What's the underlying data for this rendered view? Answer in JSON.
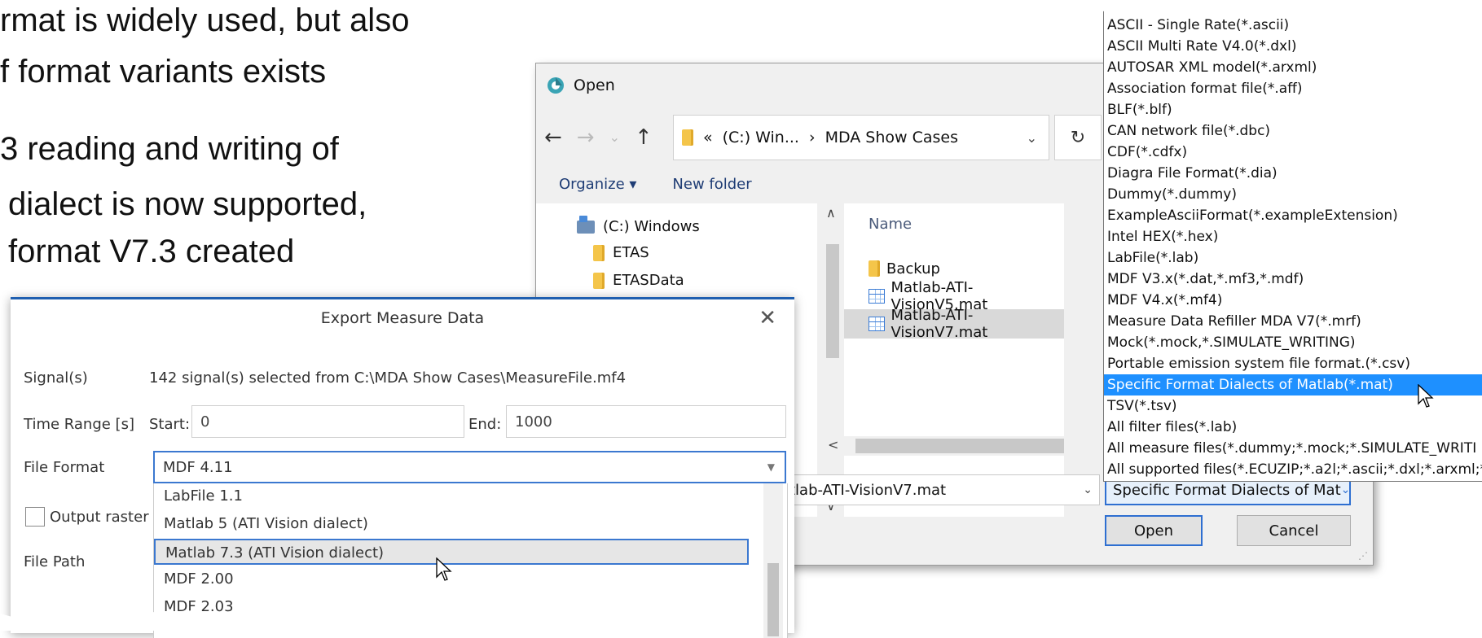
{
  "slide": {
    "line1": "rmat is widely used, but also",
    "line2": "f format variants exists",
    "line3": "3 reading and writing of",
    "line4": "dialect is now supported,",
    "line5": "format V7.3 created"
  },
  "open_dialog": {
    "title": "Open",
    "address": {
      "prefix": "«",
      "crumb1": "(C:) Win...",
      "sep": "›",
      "crumb2": "MDA Show Cases"
    },
    "organize": "Organize ▾",
    "new_folder": "New folder",
    "nav_items": [
      "(C:) Windows",
      "ETAS",
      "ETASData"
    ],
    "column_name": "Name",
    "files": [
      "Backup",
      "Matlab-ATI-VisionV5.mat",
      "Matlab-ATI-VisionV7.mat"
    ],
    "filename_value": "tlab-ATI-VisionV7.mat",
    "filter_value": "Specific Format Dialects of Mat",
    "open_label": "Open",
    "cancel_label": "Cancel"
  },
  "filter_list": [
    "ASCII - Single Rate(*.ascii)",
    "ASCII Multi Rate V4.0(*.dxl)",
    "AUTOSAR XML model(*.arxml)",
    "Association format file(*.aff)",
    "BLF(*.blf)",
    "CAN network file(*.dbc)",
    "CDF(*.cdfx)",
    "Diagra File Format(*.dia)",
    "Dummy(*.dummy)",
    "ExampleAsciiFormat(*.exampleExtension)",
    "Intel HEX(*.hex)",
    "LabFile(*.lab)",
    "MDF V3.x(*.dat,*.mf3,*.mdf)",
    "MDF V4.x(*.mf4)",
    "Measure Data Refiller MDA V7(*.mrf)",
    "Mock(*.mock,*.SIMULATE_WRITING)",
    "Portable emission system file format.(*.csv)",
    "Specific Format Dialects of Matlab(*.mat)",
    "TSV(*.tsv)",
    "All filter files(*.lab)",
    "All measure files(*.dummy;*.mock;*.SIMULATE_WRITI",
    "All supported files(*.ECUZIP;*.a2l;*.ascii;*.dxl;*.arxml;*"
  ],
  "filter_selected_index": 17,
  "export_dialog": {
    "title": "Export Measure Data",
    "signals_label": "Signal(s)",
    "signals_value": "142 signal(s) selected from C:\\MDA Show Cases\\MeasureFile.mf4",
    "time_range_label": "Time Range [s]",
    "start_label": "Start:",
    "start_value": "0",
    "end_label": "End:",
    "end_value": "1000",
    "file_format_label": "File Format",
    "file_format_value": "MDF 4.11",
    "output_raster_label": "Output raster",
    "file_path_label": "File Path",
    "format_options": [
      "LabFile 1.1",
      "Matlab 5 (ATI Vision dialect)",
      "Matlab 7.3 (ATI Vision dialect)",
      "MDF 2.00",
      "MDF 2.03"
    ],
    "format_selected_index": 2
  }
}
